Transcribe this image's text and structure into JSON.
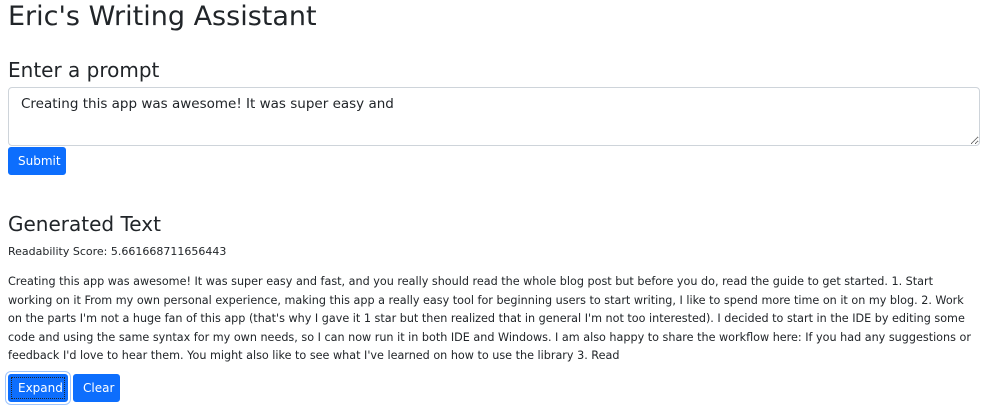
{
  "app": {
    "title": "Eric's Writing Assistant"
  },
  "prompt_section": {
    "heading": "Enter a prompt",
    "input_value": "Creating this app was awesome! It was super easy and",
    "submit_label": "Submit"
  },
  "output_section": {
    "heading": "Generated Text",
    "readability_label": "Readability Score: 5.661668711656443",
    "generated_text": "Creating this app was awesome! It was super easy and fast, and you really should read the whole blog post but before you do, read the guide to get started. 1. Start working on it From my own personal experience, making this app a really easy tool for beginning users to start writing, I like to spend more time on it on my blog. 2. Work on the parts I'm not a huge fan of this app (that's why I gave it 1 star but then realized that in general I'm not too interested). I decided to start in the IDE by editing some code and using the same syntax for my own needs, so I can now run it in both IDE and Windows. I am also happy to share the workflow here: If you had any suggestions or feedback I'd love to hear them. You might also like to see what I've learned on how to use the library 3. Read",
    "expand_label": "Expand",
    "clear_label": "Clear"
  },
  "colors": {
    "primary": "#0d6efd",
    "text": "#212529",
    "border": "#ced4da"
  }
}
